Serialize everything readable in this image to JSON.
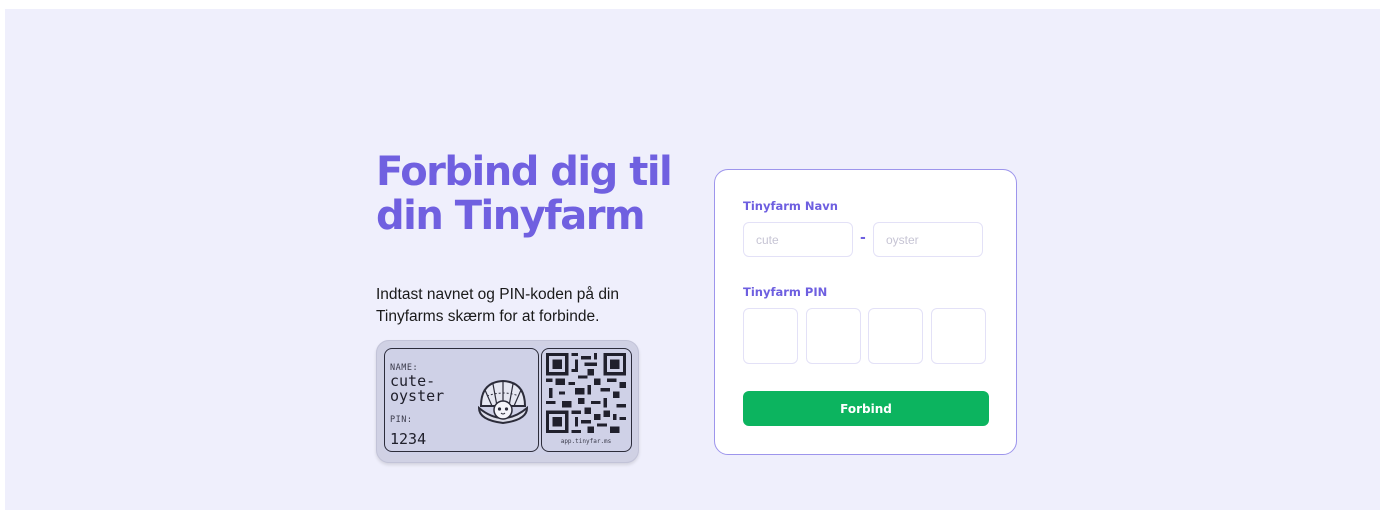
{
  "intro": {
    "headline": "Forbind dig til din Tinyfarm",
    "description": "Indtast navnet og PIN-koden på din Tinyfarms skærm for at forbinde."
  },
  "device_display": {
    "name_label": "NAME:",
    "name_value": "cute-\noyster",
    "pin_label": "PIN:",
    "pin_value": "1234",
    "qr_caption": "app.tinyfar.ms",
    "mascot_icon": "oyster-icon",
    "qr_icon": "qr-code-icon"
  },
  "form": {
    "name_label": "Tinyfarm Navn",
    "name_first_placeholder": "cute",
    "name_separator": "-",
    "name_second_placeholder": "oyster",
    "pin_label": "Tinyfarm PIN",
    "pin_digit_count": 4,
    "submit_label": "Forbind"
  },
  "colors": {
    "accent": "#7060e0",
    "button": "#0cb45f",
    "background": "#efeffc",
    "card_border": "#9d95ec"
  }
}
